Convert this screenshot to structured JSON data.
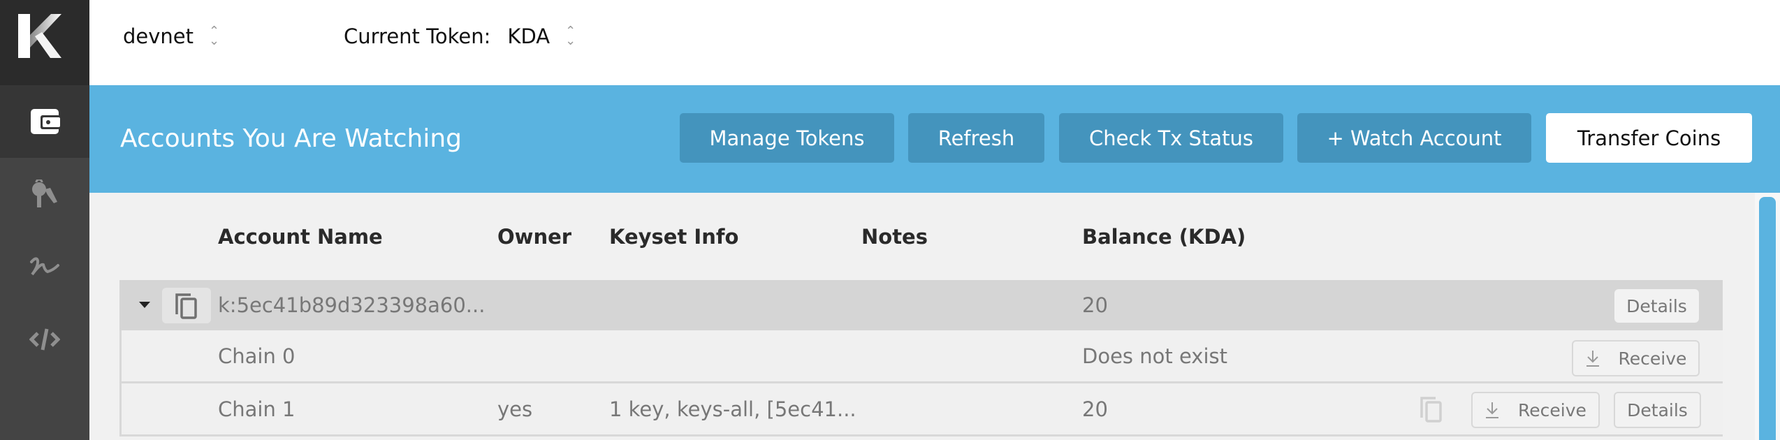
{
  "sidebar": {
    "logo": "K",
    "items": [
      {
        "name": "wallet",
        "icon": "wallet-icon",
        "active": true
      },
      {
        "name": "keys",
        "icon": "keys-icon",
        "active": false
      },
      {
        "name": "signing",
        "icon": "signature-icon",
        "active": false
      },
      {
        "name": "contracts",
        "icon": "code-icon",
        "active": false
      }
    ]
  },
  "topbar": {
    "network": "devnet",
    "token_label": "Current Token:",
    "token_value": "KDA"
  },
  "header": {
    "title": "Accounts You Are Watching",
    "buttons": {
      "manage_tokens": "Manage Tokens",
      "refresh": "Refresh",
      "check_tx": "Check Tx Status",
      "watch_account": "+ Watch Account",
      "transfer": "Transfer Coins"
    }
  },
  "table": {
    "columns": [
      "Account Name",
      "Owner",
      "Keyset Info",
      "Notes",
      "Balance (KDA)"
    ],
    "account": {
      "name": "k:5ec41b89d323398a60...",
      "balance": "20",
      "details_label": "Details"
    },
    "chains": [
      {
        "name": "Chain 0",
        "owner": "",
        "keyset": "",
        "notes": "",
        "balance": "Does not exist",
        "receive_label": "Receive"
      },
      {
        "name": "Chain 1",
        "owner": "yes",
        "keyset": "1 key, keys-all, [5ec41...",
        "notes": "",
        "balance": "20",
        "receive_label": "Receive",
        "details_label": "Details"
      }
    ]
  }
}
